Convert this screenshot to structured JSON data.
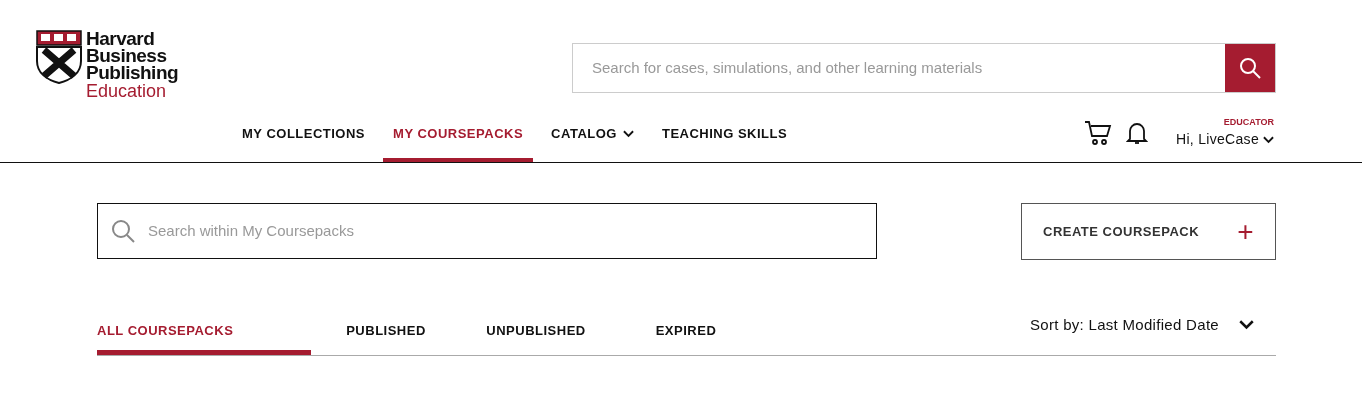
{
  "logo": {
    "lines": [
      "Harvard",
      "Business",
      "Publishing"
    ],
    "subtitle": "Education"
  },
  "header_search": {
    "placeholder": "Search for cases, simulations, and other learning materials"
  },
  "nav": [
    {
      "label": "MY COLLECTIONS",
      "selected": false,
      "dropdown": false
    },
    {
      "label": "MY COURSEPACKS",
      "selected": true,
      "dropdown": false
    },
    {
      "label": "CATALOG",
      "selected": false,
      "dropdown": true
    },
    {
      "label": "TEACHING SKILLS",
      "selected": false,
      "dropdown": false
    }
  ],
  "user": {
    "role": "EDUCATOR",
    "greeting": "Hi, LiveCase"
  },
  "coursepack_search": {
    "placeholder": "Search within My Coursepacks"
  },
  "create_button": {
    "label": "CREATE COURSEPACK",
    "icon": "+"
  },
  "tabs": [
    {
      "label": "ALL COURSEPACKS",
      "selected": true
    },
    {
      "label": "PUBLISHED",
      "selected": false
    },
    {
      "label": "UNPUBLISHED",
      "selected": false
    },
    {
      "label": "EXPIRED",
      "selected": false
    }
  ],
  "sort": {
    "label": "Sort by: Last Modified Date"
  }
}
